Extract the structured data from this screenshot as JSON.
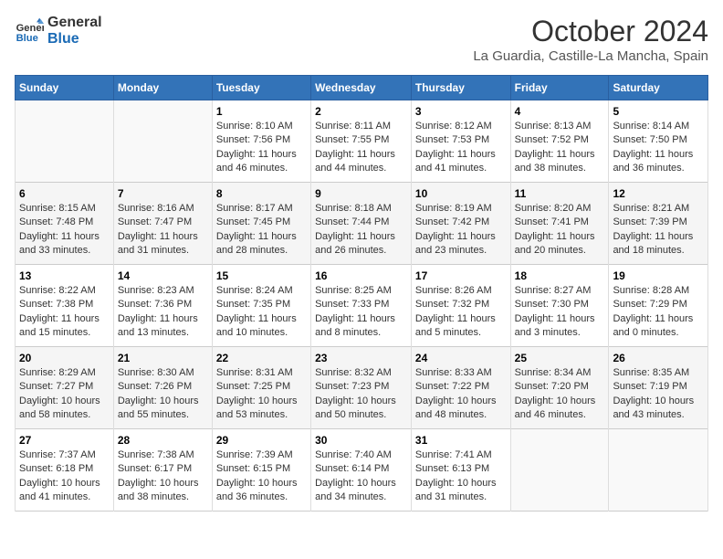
{
  "header": {
    "logo_line1": "General",
    "logo_line2": "Blue",
    "month_year": "October 2024",
    "location": "La Guardia, Castille-La Mancha, Spain"
  },
  "days_of_week": [
    "Sunday",
    "Monday",
    "Tuesday",
    "Wednesday",
    "Thursday",
    "Friday",
    "Saturday"
  ],
  "weeks": [
    [
      {
        "day": "",
        "info": ""
      },
      {
        "day": "",
        "info": ""
      },
      {
        "day": "1",
        "info": "Sunrise: 8:10 AM\nSunset: 7:56 PM\nDaylight: 11 hours and 46 minutes."
      },
      {
        "day": "2",
        "info": "Sunrise: 8:11 AM\nSunset: 7:55 PM\nDaylight: 11 hours and 44 minutes."
      },
      {
        "day": "3",
        "info": "Sunrise: 8:12 AM\nSunset: 7:53 PM\nDaylight: 11 hours and 41 minutes."
      },
      {
        "day": "4",
        "info": "Sunrise: 8:13 AM\nSunset: 7:52 PM\nDaylight: 11 hours and 38 minutes."
      },
      {
        "day": "5",
        "info": "Sunrise: 8:14 AM\nSunset: 7:50 PM\nDaylight: 11 hours and 36 minutes."
      }
    ],
    [
      {
        "day": "6",
        "info": "Sunrise: 8:15 AM\nSunset: 7:48 PM\nDaylight: 11 hours and 33 minutes."
      },
      {
        "day": "7",
        "info": "Sunrise: 8:16 AM\nSunset: 7:47 PM\nDaylight: 11 hours and 31 minutes."
      },
      {
        "day": "8",
        "info": "Sunrise: 8:17 AM\nSunset: 7:45 PM\nDaylight: 11 hours and 28 minutes."
      },
      {
        "day": "9",
        "info": "Sunrise: 8:18 AM\nSunset: 7:44 PM\nDaylight: 11 hours and 26 minutes."
      },
      {
        "day": "10",
        "info": "Sunrise: 8:19 AM\nSunset: 7:42 PM\nDaylight: 11 hours and 23 minutes."
      },
      {
        "day": "11",
        "info": "Sunrise: 8:20 AM\nSunset: 7:41 PM\nDaylight: 11 hours and 20 minutes."
      },
      {
        "day": "12",
        "info": "Sunrise: 8:21 AM\nSunset: 7:39 PM\nDaylight: 11 hours and 18 minutes."
      }
    ],
    [
      {
        "day": "13",
        "info": "Sunrise: 8:22 AM\nSunset: 7:38 PM\nDaylight: 11 hours and 15 minutes."
      },
      {
        "day": "14",
        "info": "Sunrise: 8:23 AM\nSunset: 7:36 PM\nDaylight: 11 hours and 13 minutes."
      },
      {
        "day": "15",
        "info": "Sunrise: 8:24 AM\nSunset: 7:35 PM\nDaylight: 11 hours and 10 minutes."
      },
      {
        "day": "16",
        "info": "Sunrise: 8:25 AM\nSunset: 7:33 PM\nDaylight: 11 hours and 8 minutes."
      },
      {
        "day": "17",
        "info": "Sunrise: 8:26 AM\nSunset: 7:32 PM\nDaylight: 11 hours and 5 minutes."
      },
      {
        "day": "18",
        "info": "Sunrise: 8:27 AM\nSunset: 7:30 PM\nDaylight: 11 hours and 3 minutes."
      },
      {
        "day": "19",
        "info": "Sunrise: 8:28 AM\nSunset: 7:29 PM\nDaylight: 11 hours and 0 minutes."
      }
    ],
    [
      {
        "day": "20",
        "info": "Sunrise: 8:29 AM\nSunset: 7:27 PM\nDaylight: 10 hours and 58 minutes."
      },
      {
        "day": "21",
        "info": "Sunrise: 8:30 AM\nSunset: 7:26 PM\nDaylight: 10 hours and 55 minutes."
      },
      {
        "day": "22",
        "info": "Sunrise: 8:31 AM\nSunset: 7:25 PM\nDaylight: 10 hours and 53 minutes."
      },
      {
        "day": "23",
        "info": "Sunrise: 8:32 AM\nSunset: 7:23 PM\nDaylight: 10 hours and 50 minutes."
      },
      {
        "day": "24",
        "info": "Sunrise: 8:33 AM\nSunset: 7:22 PM\nDaylight: 10 hours and 48 minutes."
      },
      {
        "day": "25",
        "info": "Sunrise: 8:34 AM\nSunset: 7:20 PM\nDaylight: 10 hours and 46 minutes."
      },
      {
        "day": "26",
        "info": "Sunrise: 8:35 AM\nSunset: 7:19 PM\nDaylight: 10 hours and 43 minutes."
      }
    ],
    [
      {
        "day": "27",
        "info": "Sunrise: 7:37 AM\nSunset: 6:18 PM\nDaylight: 10 hours and 41 minutes."
      },
      {
        "day": "28",
        "info": "Sunrise: 7:38 AM\nSunset: 6:17 PM\nDaylight: 10 hours and 38 minutes."
      },
      {
        "day": "29",
        "info": "Sunrise: 7:39 AM\nSunset: 6:15 PM\nDaylight: 10 hours and 36 minutes."
      },
      {
        "day": "30",
        "info": "Sunrise: 7:40 AM\nSunset: 6:14 PM\nDaylight: 10 hours and 34 minutes."
      },
      {
        "day": "31",
        "info": "Sunrise: 7:41 AM\nSunset: 6:13 PM\nDaylight: 10 hours and 31 minutes."
      },
      {
        "day": "",
        "info": ""
      },
      {
        "day": "",
        "info": ""
      }
    ]
  ]
}
